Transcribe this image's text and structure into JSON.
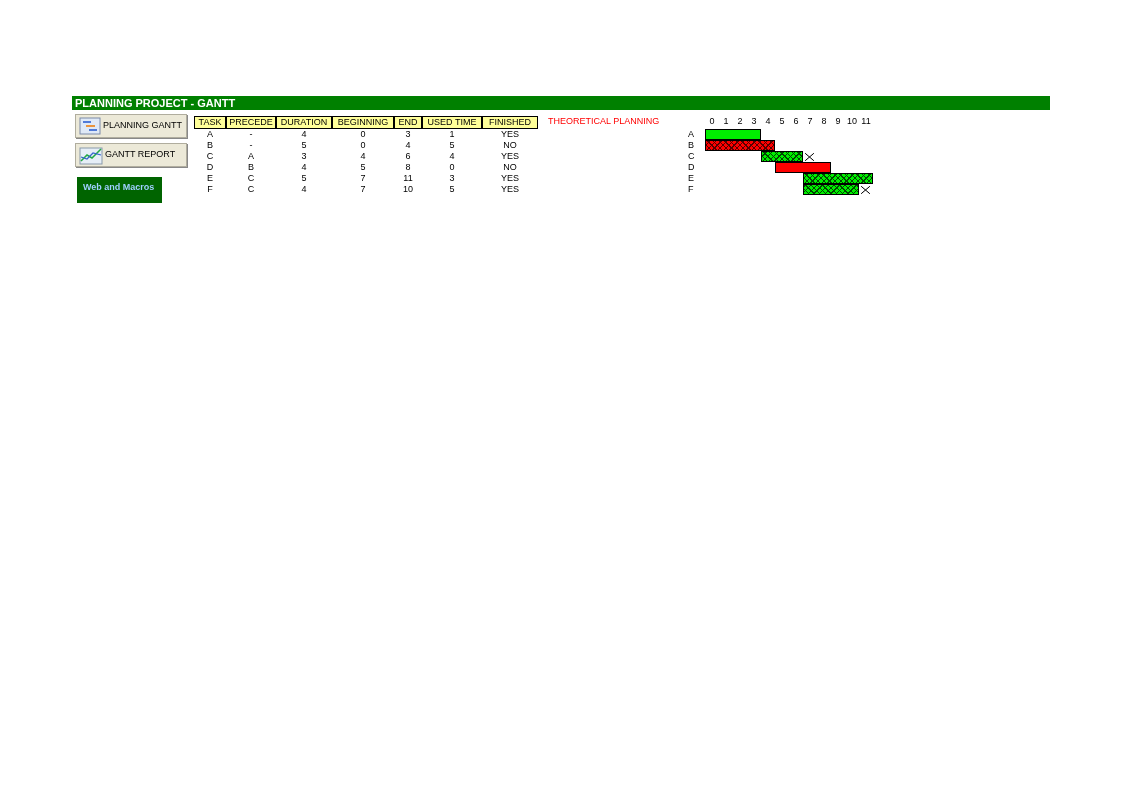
{
  "title": "PLANNING PROJECT - GANTT",
  "buttons": [
    {
      "label": "PLANNING GANTT",
      "kind": "planning"
    },
    {
      "label": "GANTT REPORT",
      "kind": "report"
    }
  ],
  "logo": {
    "text": "Web and Macros"
  },
  "table": {
    "columns": [
      "TASK",
      "PRECEDE",
      "DURATION",
      "BEGINNING",
      "END",
      "USED TIME",
      "FINISHED"
    ],
    "rows": [
      [
        "A",
        "-",
        "4",
        "0",
        "3",
        "1",
        "YES"
      ],
      [
        "B",
        "-",
        "5",
        "0",
        "4",
        "5",
        "NO"
      ],
      [
        "C",
        "A",
        "3",
        "4",
        "6",
        "4",
        "YES"
      ],
      [
        "D",
        "B",
        "4",
        "5",
        "8",
        "0",
        "NO"
      ],
      [
        "E",
        "C",
        "5",
        "7",
        "11",
        "3",
        "YES"
      ],
      [
        "F",
        "C",
        "4",
        "7",
        "10",
        "5",
        "YES"
      ]
    ]
  },
  "gantt": {
    "title": "THEORETICAL PLANNING",
    "timeline": [
      "0",
      "1",
      "2",
      "3",
      "4",
      "5",
      "6",
      "7",
      "8",
      "9",
      "10",
      "11"
    ],
    "rows": [
      {
        "label": "A",
        "hatched": false,
        "overrun": false
      },
      {
        "label": "B",
        "hatched": true,
        "overrun": false
      },
      {
        "label": "C",
        "hatched": true,
        "overrun": true
      },
      {
        "label": "D",
        "hatched": false,
        "overrun": false
      },
      {
        "label": "E",
        "hatched": true,
        "overrun": false
      },
      {
        "label": "F",
        "hatched": true,
        "overrun": true
      }
    ]
  }
}
